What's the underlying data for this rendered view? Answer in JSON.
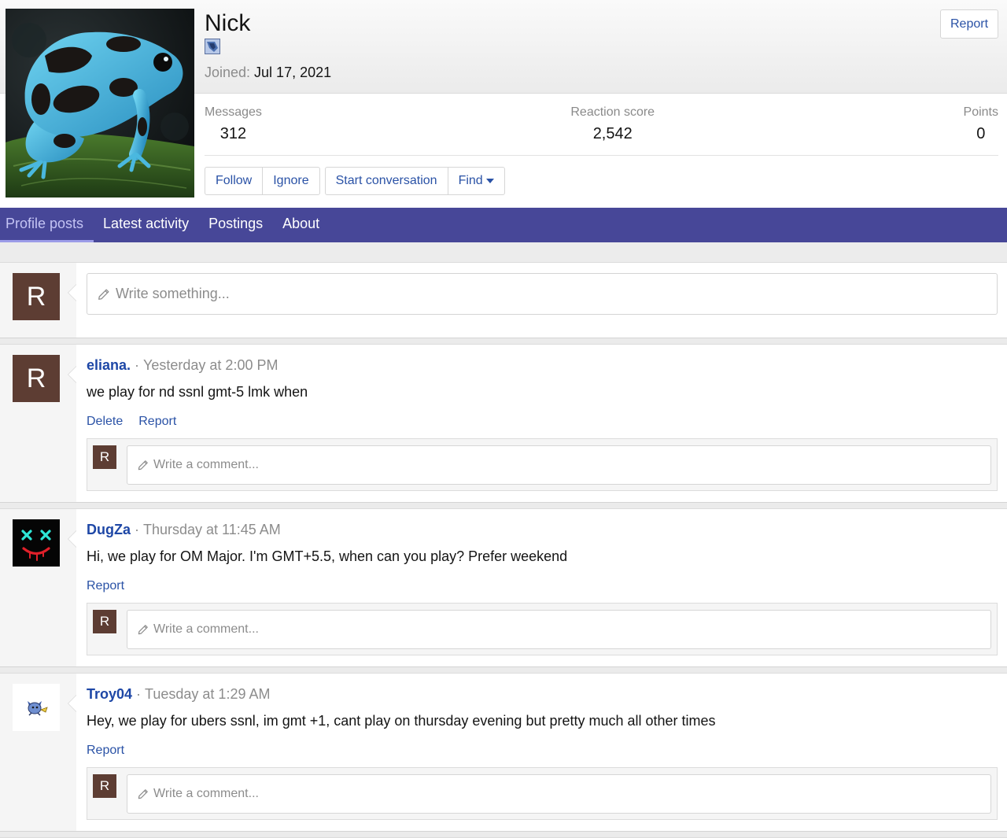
{
  "colors": {
    "nav_bar": "#474798",
    "link": "#2a52a6",
    "username": "#1e47a6",
    "avatar_letter_bg": "#5d3d33"
  },
  "profile": {
    "name": "Nick",
    "joined_label": "Joined:",
    "joined_date": "Jul 17, 2021",
    "report_label": "Report",
    "stats": [
      {
        "label": "Messages",
        "value": "312"
      },
      {
        "label": "Reaction score",
        "value": "2,542"
      },
      {
        "label": "Points",
        "value": "0"
      }
    ],
    "buttons": {
      "follow": "Follow",
      "ignore": "Ignore",
      "start_conversation": "Start conversation",
      "find": "Find"
    }
  },
  "tabs": [
    {
      "label": "Profile posts",
      "active": true
    },
    {
      "label": "Latest activity",
      "active": false
    },
    {
      "label": "Postings",
      "active": false
    },
    {
      "label": "About",
      "active": false
    }
  ],
  "composer": {
    "avatar_letter": "R",
    "placeholder": "Write something..."
  },
  "posts": [
    {
      "author": "eliana.",
      "separator": "·",
      "time": "Yesterday at 2:00 PM",
      "avatar_letter": "R",
      "message": "we play for nd ssnl gmt-5 lmk when",
      "actions": [
        "Delete",
        "Report"
      ],
      "comment": {
        "avatar_letter": "R",
        "placeholder": "Write a comment..."
      }
    },
    {
      "author": "DugZa",
      "separator": "·",
      "time": "Thursday at 11:45 AM",
      "message": "Hi, we play for OM Major. I'm GMT+5.5, when can you play? Prefer weekend",
      "actions": [
        "Report"
      ],
      "comment": {
        "avatar_letter": "R",
        "placeholder": "Write a comment..."
      }
    },
    {
      "author": "Troy04",
      "separator": "·",
      "time": "Tuesday at 1:29 AM",
      "message": "Hey, we play for ubers ssnl, im gmt +1, cant play on thursday evening but pretty much all other times",
      "actions": [
        "Report"
      ],
      "comment": {
        "avatar_letter": "R",
        "placeholder": "Write a comment..."
      }
    }
  ]
}
